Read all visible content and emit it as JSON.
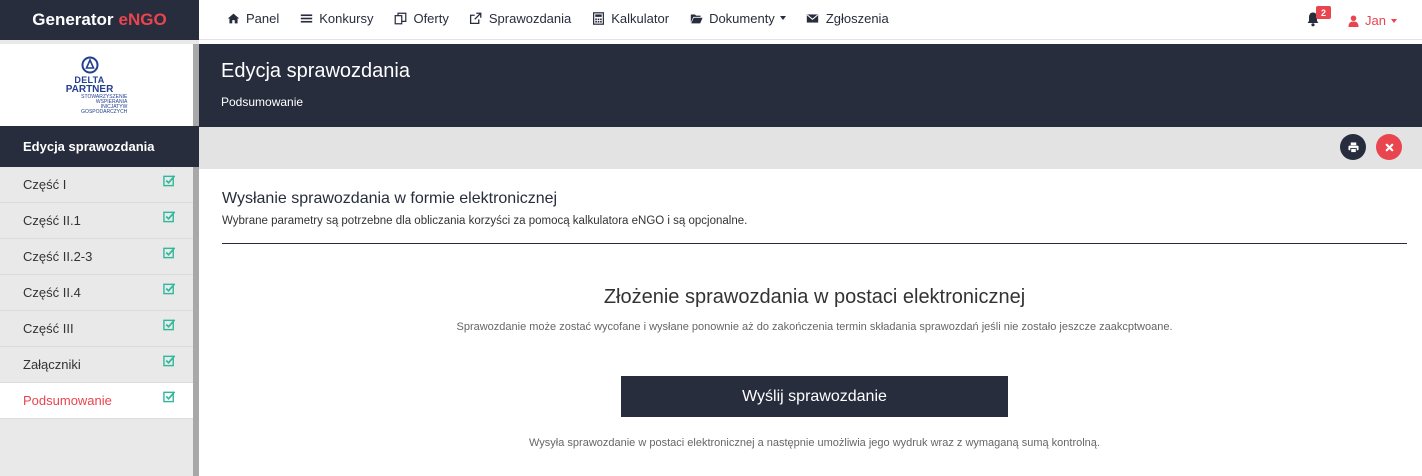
{
  "brand": {
    "name": "Generator",
    "accent": "eNGO"
  },
  "nav": [
    {
      "label": "Panel",
      "icon": "home-icon"
    },
    {
      "label": "Konkursy",
      "icon": "list-icon"
    },
    {
      "label": "Oferty",
      "icon": "copy-icon"
    },
    {
      "label": "Sprawozdania",
      "icon": "external-link-icon"
    },
    {
      "label": "Kalkulator",
      "icon": "calculator-icon"
    },
    {
      "label": "Dokumenty",
      "icon": "folder-open-icon",
      "dropdown": true
    },
    {
      "label": "Zgłoszenia",
      "icon": "envelope-icon"
    }
  ],
  "notifications": {
    "count": "2"
  },
  "user": {
    "name": "Jan"
  },
  "logo": {
    "line1": "DELTA",
    "line2": "PARTNER",
    "sub": [
      "STOWARZYSZENIE",
      "WSPIERANIA",
      "INICJATYW",
      "GOSPODARCZYCH"
    ]
  },
  "sidebar": {
    "heading": "Edycja sprawozdania",
    "items": [
      {
        "label": "Część I",
        "active": false
      },
      {
        "label": "Część II.1",
        "active": false
      },
      {
        "label": "Część II.2-3",
        "active": false
      },
      {
        "label": "Część II.4",
        "active": false
      },
      {
        "label": "Część III",
        "active": false
      },
      {
        "label": "Załączniki",
        "active": false
      },
      {
        "label": "Podsumowanie",
        "active": true
      }
    ]
  },
  "header": {
    "title": "Edycja sprawozdania",
    "subtitle": "Podsumowanie"
  },
  "section": {
    "title": "Wysłanie sprawozdania w formie elektronicznej",
    "description": "Wybrane parametry są potrzebne dla obliczania korzyści za pomocą kalkulatora eNGO i są opcjonalne."
  },
  "submit": {
    "title": "Złożenie sprawozdania w postaci elektronicznej",
    "description": "Sprawozdanie może zostać wycofane i wysłane ponownie aż do zakończenia termin składania sprawozdań jeśli nie zostało jeszcze zaakcptwoane.",
    "button_label": "Wyślij sprawozdanie",
    "button_description": "Wysyła sprawozdanie w postaci elektronicznej a następnie umożliwia jego wydruk wraz z wymaganą sumą kontrolną."
  },
  "colors": {
    "dark": "#272d3c",
    "accent": "#e9454f",
    "check": "#2fb89a"
  }
}
